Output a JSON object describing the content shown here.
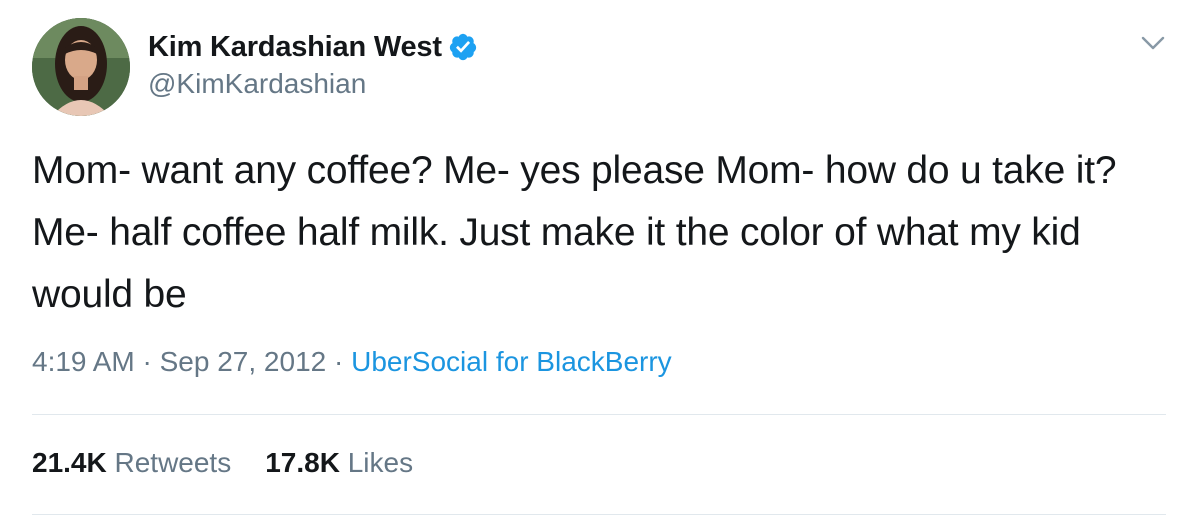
{
  "tweet": {
    "author": {
      "display_name": "Kim Kardashian West",
      "handle": "@KimKardashian",
      "verified": true
    },
    "text": "Mom- want any coffee? Me- yes please Mom- how do u take it? Me- half coffee half milk. Just make it the color of what my kid would be",
    "meta": {
      "time": "4:19 AM",
      "separator": " · ",
      "date": "Sep 27, 2012",
      "source": "UberSocial for BlackBerry"
    },
    "stats": {
      "retweets_count": "21.4K",
      "retweets_label": " Retweets",
      "likes_count": "17.8K",
      "likes_label": " Likes"
    }
  },
  "icons": {
    "verified": "verified-badge-icon",
    "menu": "chevron-down-icon"
  },
  "colors": {
    "primary_text": "#14171a",
    "secondary_text": "#657786",
    "link": "#1b95e0",
    "verified_badge": "#1da1f2",
    "divider": "#e1e8ed"
  }
}
